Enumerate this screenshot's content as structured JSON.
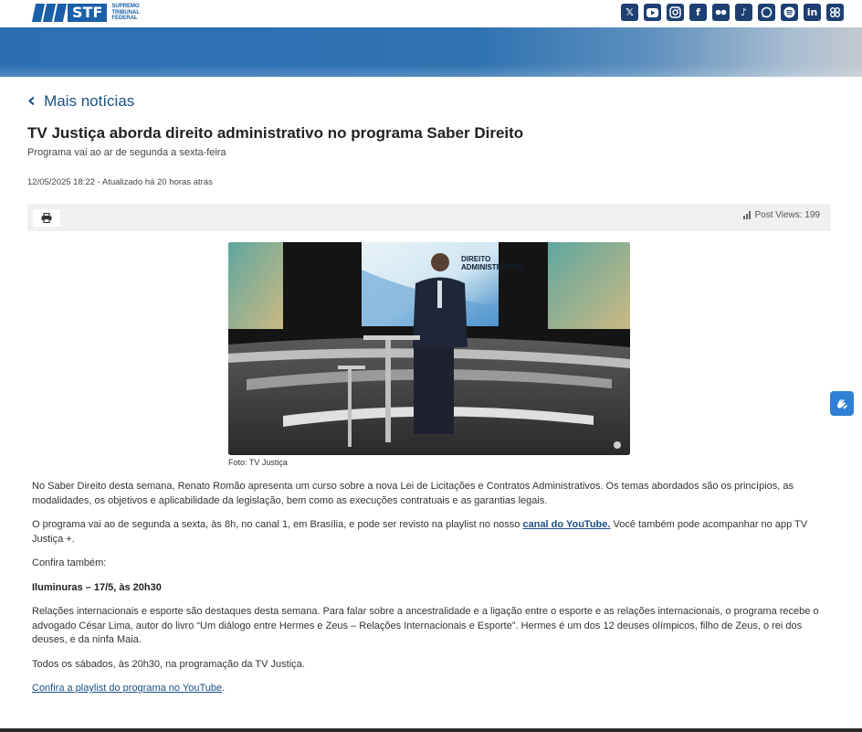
{
  "header": {
    "logo_text": "STF",
    "logo_lines": [
      "Supremo",
      "Tribunal",
      "Federal"
    ],
    "social_icons": [
      "x-icon",
      "youtube-icon",
      "instagram-icon",
      "facebook-icon",
      "flickr-icon",
      "tiktok-icon",
      "whatsapp-icon",
      "spotify-icon",
      "linkedin-icon",
      "app-icon"
    ]
  },
  "nav": {
    "back_label": "Mais notícias"
  },
  "article": {
    "title": "TV Justiça aborda direito administrativo no programa Saber Direito",
    "subtitle": "Programa vai ao ar de segunda a sexta-feira",
    "date": "12/05/2025 18:22 - Atualizado há 20 horas atrás",
    "views_label": "Post Views: 199",
    "photo_caption": "Foto: TV Justiça",
    "screen_text_1": "DIREITO",
    "screen_text_2": "ADMINISTRATIVO",
    "p1": "No Saber Direito desta semana, Renato Romão apresenta um curso sobre a nova Lei de Licitações e Contratos Administrativos. Os temas abordados são os princípios, as modalidades, os objetivos e aplicabilidade da legislação, bem como as execuções contratuais e as garantias legais.",
    "p2_before": "O programa vai ao de segunda a sexta, às 8h, no canal 1, em Brasília, e pode ser revisto na playlist no nosso ",
    "p2_link": "canal do YouTube.",
    "p2_after": " Você também pode acompanhar no app TV Justiça +.",
    "p3": "Confira também:",
    "p4": "Iluminuras – 17/5, às 20h30",
    "p5": "Relações internacionais e esporte são destaques desta semana. Para falar sobre a ancestralidade e a ligação entre o esporte e as relações internacionais, o programa recebe o advogado César Lima, autor do livro “Um diálogo entre Hermes e Zeus – Relações Internacionais e Esporte”. Hermes é um dos 12 deuses olímpicos, filho de Zeus, o rei dos deuses, e da ninfa Maia.",
    "p6": "Todos os sábados, às 20h30, na programação da TV Justiça.",
    "p7_link": "Confira a playlist do programa no YouTube",
    "p7_after": "."
  },
  "colors": {
    "brand": "#1b5fa8",
    "link": "#1d4f85",
    "social_bg": "#1d3f72",
    "a11y": "#2f7fd6"
  }
}
